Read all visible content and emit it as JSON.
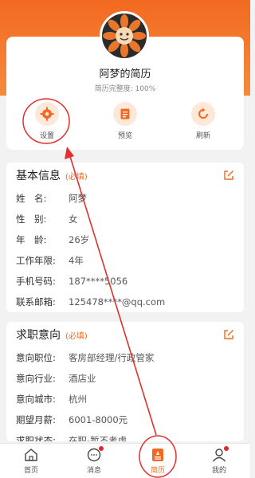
{
  "profile": {
    "name": "阿梦的简历",
    "completeness": "简历完整度: 100%"
  },
  "actions": [
    {
      "label": "设置",
      "icon": "gear-icon"
    },
    {
      "label": "预览",
      "icon": "document-icon"
    },
    {
      "label": "刷新",
      "icon": "refresh-icon"
    }
  ],
  "basic_info": {
    "title": "基本信息",
    "required": "(必填)",
    "rows": [
      {
        "key": "姓　名:",
        "value": "阿梦"
      },
      {
        "key": "性　别:",
        "value": "女"
      },
      {
        "key": "年　龄:",
        "value": "26岁"
      },
      {
        "key": "工作年限:",
        "value": "4年"
      },
      {
        "key": "手机号码:",
        "value": "187****5056"
      },
      {
        "key": "联系邮箱:",
        "value": "125478****@qq.com"
      }
    ]
  },
  "job_intent": {
    "title": "求职意向",
    "required": "(必填)",
    "rows": [
      {
        "key": "意向职位:",
        "value": "客房部经理/行政管家"
      },
      {
        "key": "意向行业:",
        "value": "酒店业"
      },
      {
        "key": "意向城市:",
        "value": "杭州"
      },
      {
        "key": "期望月薪:",
        "value": "6001-8000元"
      },
      {
        "key": "求职状态:",
        "value": "在职-暂不考虑"
      }
    ]
  },
  "tabbar": [
    {
      "label": "首页",
      "icon": "home-icon"
    },
    {
      "label": "消息",
      "icon": "message-icon"
    },
    {
      "label": "简历",
      "icon": "resume-icon"
    },
    {
      "label": "我的",
      "icon": "user-icon"
    }
  ],
  "colors": {
    "accent": "#f26a21",
    "annotation": "#e03030"
  }
}
